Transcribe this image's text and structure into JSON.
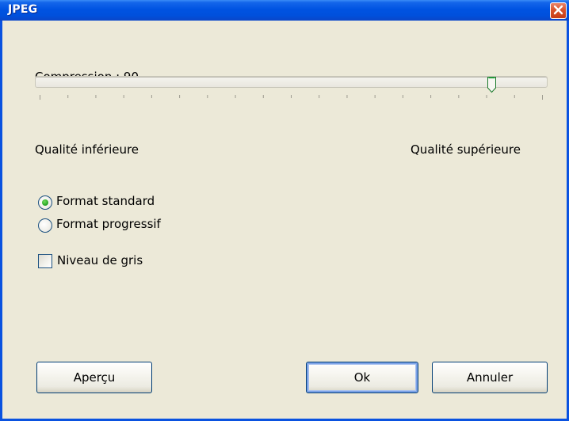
{
  "window": {
    "title": "JPEG",
    "close_icon": "close-icon"
  },
  "compression": {
    "label": "Compression : 90",
    "value": 90,
    "min": 0,
    "max": 100,
    "tick_count": 19,
    "low_label": "Qualité inférieure",
    "high_label": "Qualité supérieure"
  },
  "format": {
    "options": [
      {
        "label": "Format standard",
        "selected": true
      },
      {
        "label": "Format progressif",
        "selected": false
      }
    ]
  },
  "grayscale": {
    "label": "Niveau de gris",
    "checked": false
  },
  "buttons": {
    "preview": "Aperçu",
    "ok": "Ok",
    "cancel": "Annuler"
  },
  "colors": {
    "titlebar": "#0053e2",
    "client_bg": "#ece9d8",
    "radio_dot": "#21a121",
    "close_button": "#d9532c"
  }
}
